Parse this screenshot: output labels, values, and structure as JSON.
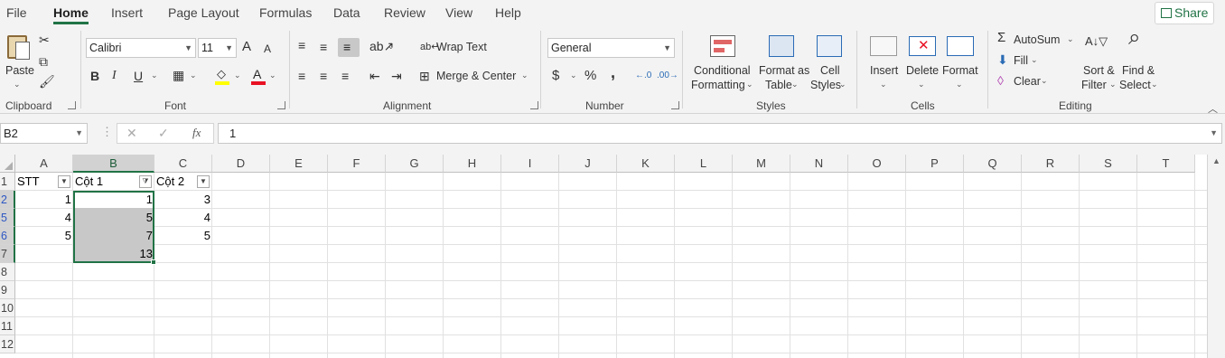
{
  "menu": {
    "tabs": [
      "File",
      "Home",
      "Insert",
      "Page Layout",
      "Formulas",
      "Data",
      "Review",
      "View",
      "Help"
    ],
    "active": "Home",
    "share_label": "Share"
  },
  "ribbon": {
    "clipboard": {
      "paste": "Paste",
      "label": "Clipboard"
    },
    "font": {
      "name": "Calibri",
      "size": "11",
      "bold": "B",
      "italic": "I",
      "underline": "U",
      "label": "Font",
      "grow": "A",
      "shrink": "A"
    },
    "alignment": {
      "wrap": "Wrap Text",
      "merge": "Merge & Center",
      "label": "Alignment"
    },
    "number": {
      "format": "General",
      "currency": "$",
      "percent": "%",
      "comma": ",",
      "label": "Number"
    },
    "styles": {
      "conditional1": "Conditional",
      "conditional2": "Formatting",
      "format_as1": "Format as",
      "format_as2": "Table",
      "cell1": "Cell",
      "cell2": "Styles",
      "label": "Styles"
    },
    "cells": {
      "insert": "Insert",
      "delete": "Delete",
      "format": "Format",
      "label": "Cells"
    },
    "editing": {
      "autosum": "AutoSum",
      "fill": "Fill",
      "clear": "Clear",
      "sort1": "Sort &",
      "sort2": "Filter",
      "find1": "Find &",
      "find2": "Select",
      "label": "Editing"
    }
  },
  "formula_bar": {
    "name_box": "B2",
    "fx": "fx",
    "value": "1"
  },
  "sheet": {
    "columns": [
      "A",
      "B",
      "C",
      "D",
      "E",
      "F",
      "G",
      "H",
      "I",
      "J",
      "K",
      "L",
      "M",
      "N",
      "O",
      "P",
      "Q",
      "R",
      "S",
      "T"
    ],
    "rows": [
      "1",
      "2",
      "5",
      "6",
      "7",
      "8",
      "9",
      "10",
      "11",
      "12"
    ],
    "selected_column": "B",
    "header_row": [
      "STT",
      "Cột 1",
      "Cột 2"
    ],
    "data": [
      [
        "1",
        "1",
        "3"
      ],
      [
        "4",
        "5",
        "4"
      ],
      [
        "5",
        "7",
        "5"
      ],
      [
        "",
        "13",
        ""
      ]
    ]
  },
  "colors": {
    "accent": "#217346",
    "selection": "#c8c8c8",
    "filtered_row_number": "#2d57c3"
  }
}
